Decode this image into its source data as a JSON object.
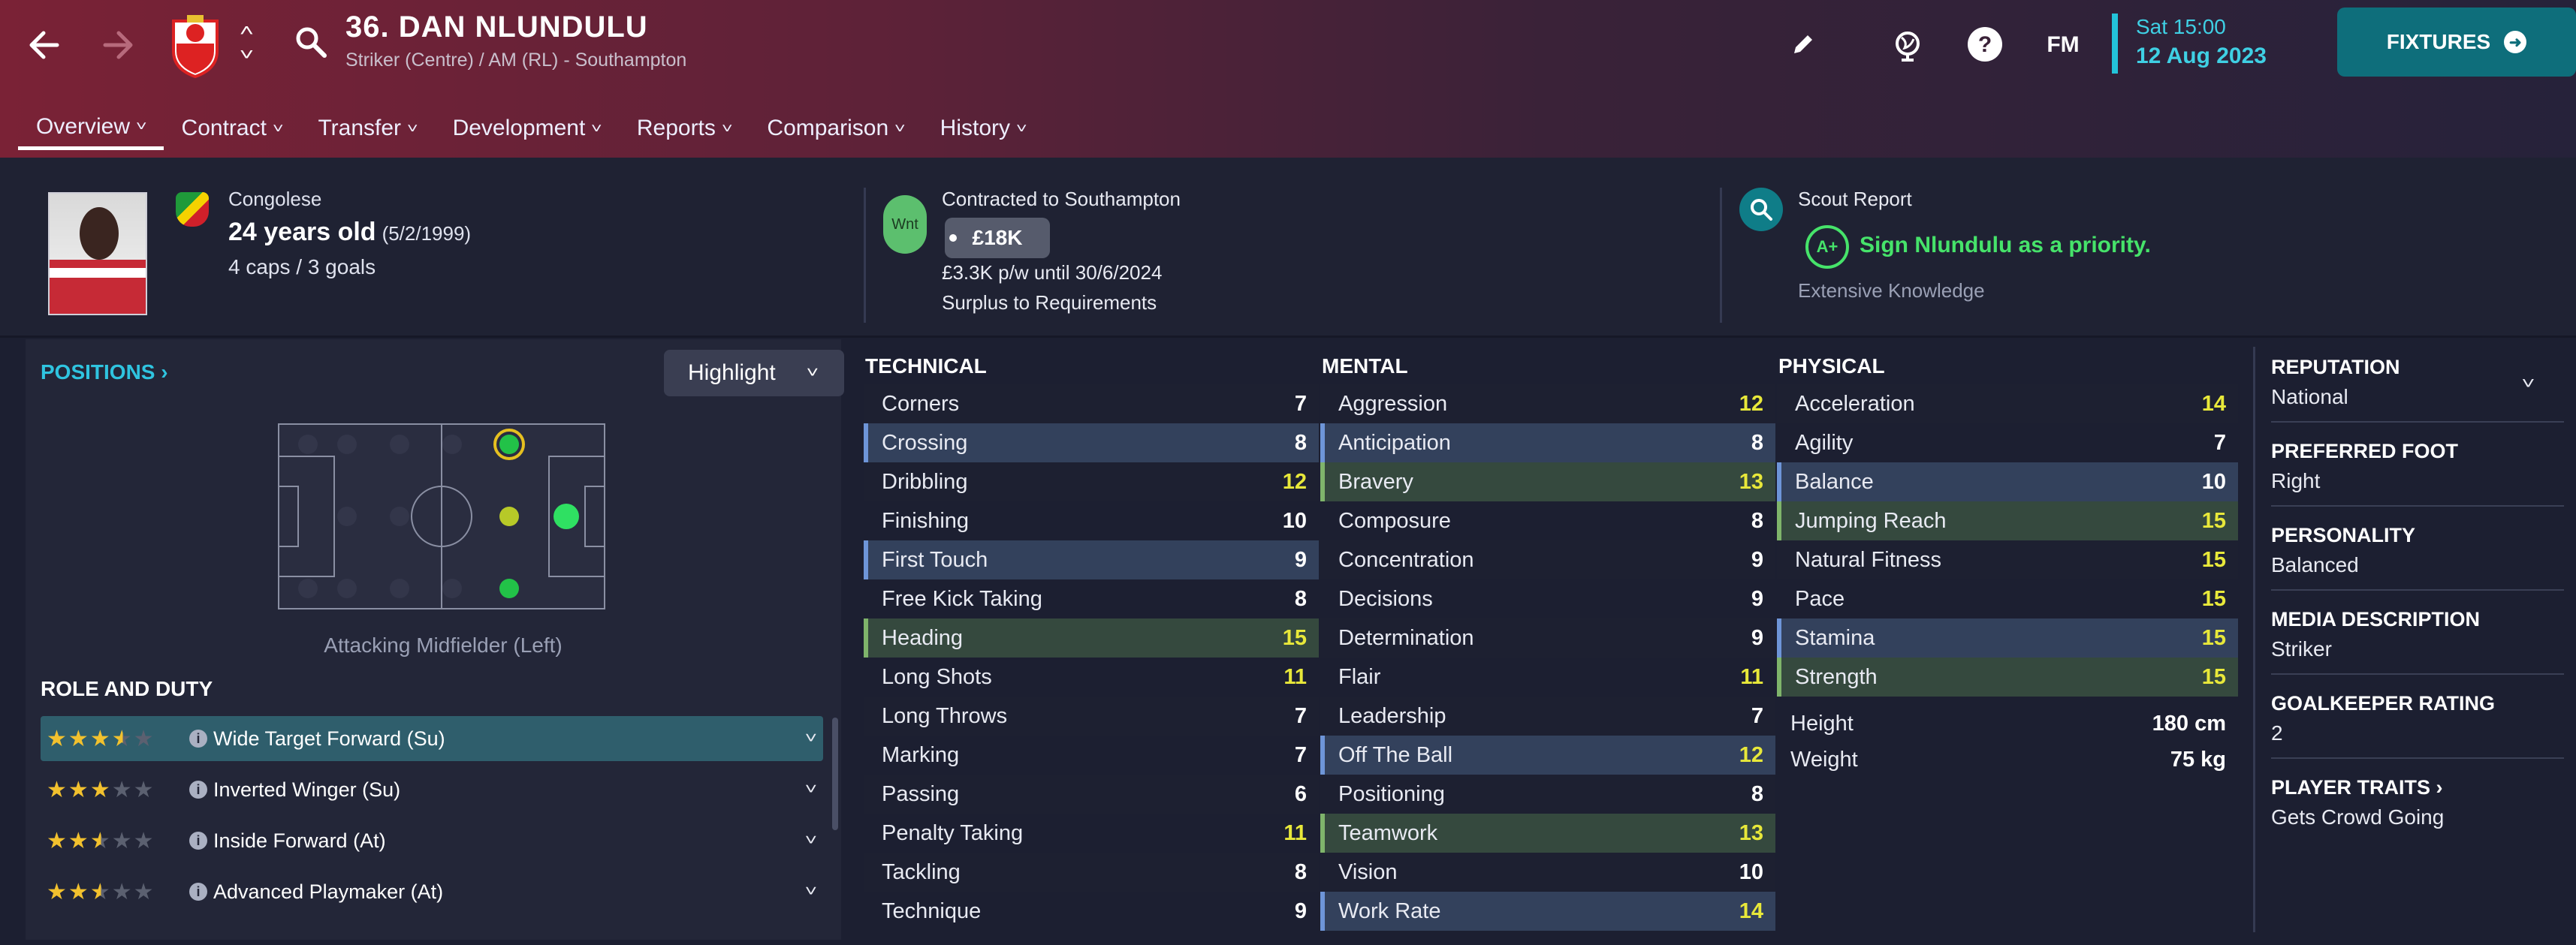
{
  "header": {
    "title": "36. DAN NLUNDULU",
    "subtitle": "Striker (Centre) / AM (RL) - Southampton",
    "fm_label": "FM",
    "date_time": "Sat 15:00",
    "date": "12 Aug 2023",
    "fixtures_label": "FIXTURES"
  },
  "nav": [
    {
      "label": "Overview",
      "active": true
    },
    {
      "label": "Contract"
    },
    {
      "label": "Transfer"
    },
    {
      "label": "Development"
    },
    {
      "label": "Reports"
    },
    {
      "label": "Comparison"
    },
    {
      "label": "History"
    }
  ],
  "player": {
    "nationality": "Congolese",
    "age": "24 years old",
    "dob": "(5/2/1999)",
    "caps": "4 caps / 3 goals"
  },
  "contract": {
    "badge": "Wnt",
    "title": "Contracted to Southampton",
    "fee": "£18K",
    "wage": "£3.3K p/w until 30/6/2024",
    "status": "Surplus to Requirements"
  },
  "scout": {
    "title": "Scout Report",
    "grade": "A+",
    "recommendation": "Sign Nlundulu as a priority.",
    "knowledge": "Extensive Knowledge"
  },
  "positions": {
    "link": "POSITIONS",
    "highlight": "Highlight",
    "description": "Attacking Midfielder (Left)"
  },
  "roles": {
    "heading": "ROLE AND DUTY",
    "items": [
      {
        "name": "Wide Target Forward (Su)",
        "stars": 3.5,
        "selected": true
      },
      {
        "name": "Inverted Winger (Su)",
        "stars": 3
      },
      {
        "name": "Inside Forward (At)",
        "stars": 2.5
      },
      {
        "name": "Advanced Playmaker (At)",
        "stars": 2.5
      }
    ]
  },
  "attributes": {
    "technical": {
      "heading": "TECHNICAL",
      "items": [
        {
          "name": "Corners",
          "value": 7
        },
        {
          "name": "Crossing",
          "value": 8,
          "hl": "b"
        },
        {
          "name": "Dribbling",
          "value": 12
        },
        {
          "name": "Finishing",
          "value": 10
        },
        {
          "name": "First Touch",
          "value": 9,
          "hl": "b"
        },
        {
          "name": "Free Kick Taking",
          "value": 8
        },
        {
          "name": "Heading",
          "value": 15,
          "hl": "g"
        },
        {
          "name": "Long Shots",
          "value": 11
        },
        {
          "name": "Long Throws",
          "value": 7
        },
        {
          "name": "Marking",
          "value": 7
        },
        {
          "name": "Passing",
          "value": 6
        },
        {
          "name": "Penalty Taking",
          "value": 11
        },
        {
          "name": "Tackling",
          "value": 8
        },
        {
          "name": "Technique",
          "value": 9
        }
      ]
    },
    "mental": {
      "heading": "MENTAL",
      "items": [
        {
          "name": "Aggression",
          "value": 12
        },
        {
          "name": "Anticipation",
          "value": 8,
          "hl": "b"
        },
        {
          "name": "Bravery",
          "value": 13,
          "hl": "g"
        },
        {
          "name": "Composure",
          "value": 8
        },
        {
          "name": "Concentration",
          "value": 9
        },
        {
          "name": "Decisions",
          "value": 9
        },
        {
          "name": "Determination",
          "value": 9
        },
        {
          "name": "Flair",
          "value": 11
        },
        {
          "name": "Leadership",
          "value": 7
        },
        {
          "name": "Off The Ball",
          "value": 12,
          "hl": "b"
        },
        {
          "name": "Positioning",
          "value": 8
        },
        {
          "name": "Teamwork",
          "value": 13,
          "hl": "g"
        },
        {
          "name": "Vision",
          "value": 10
        },
        {
          "name": "Work Rate",
          "value": 14,
          "hl": "b"
        }
      ]
    },
    "physical": {
      "heading": "PHYSICAL",
      "items": [
        {
          "name": "Acceleration",
          "value": 14
        },
        {
          "name": "Agility",
          "value": 7
        },
        {
          "name": "Balance",
          "value": 10,
          "hl": "b"
        },
        {
          "name": "Jumping Reach",
          "value": 15,
          "hl": "g"
        },
        {
          "name": "Natural Fitness",
          "value": 15
        },
        {
          "name": "Pace",
          "value": 15
        },
        {
          "name": "Stamina",
          "value": 15,
          "hl": "b"
        },
        {
          "name": "Strength",
          "value": 15,
          "hl": "g"
        }
      ],
      "height_label": "Height",
      "height": "180 cm",
      "weight_label": "Weight",
      "weight": "75 kg"
    }
  },
  "sidebar": [
    {
      "label": "REPUTATION",
      "value": "National"
    },
    {
      "label": "PREFERRED FOOT",
      "value": "Right"
    },
    {
      "label": "PERSONALITY",
      "value": "Balanced"
    },
    {
      "label": "MEDIA DESCRIPTION",
      "value": "Striker"
    },
    {
      "label": "GOALKEEPER RATING",
      "value": "2"
    },
    {
      "label": "PLAYER TRAITS",
      "value": "Gets Crowd Going"
    }
  ],
  "colors": {
    "accent": "#2fc4e0",
    "highlight_yellow": "#e8e83a",
    "positive_green": "#46e36a",
    "fixtures_bg": "#0e6e7b"
  }
}
